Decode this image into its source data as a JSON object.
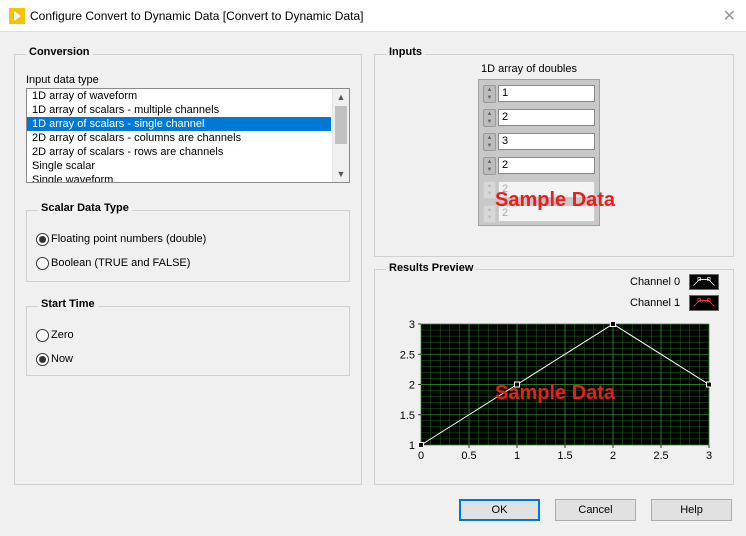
{
  "window": {
    "title": "Configure Convert to Dynamic Data [Convert to Dynamic Data]",
    "close_glyph": "✕"
  },
  "conversion": {
    "group_label": "Conversion",
    "input_type_label": "Input data type",
    "items": [
      "1D array of waveform",
      "1D array of scalars - multiple channels",
      "1D array of scalars - single channel",
      "2D array of scalars - columns are channels",
      "2D array of scalars - rows are channels",
      "Single scalar",
      "Single waveform"
    ],
    "selected_index": 2
  },
  "scalar_type": {
    "group_label": "Scalar Data Type",
    "options": [
      "Floating point numbers (double)",
      "Boolean (TRUE and FALSE)"
    ],
    "selected": 0
  },
  "start_time": {
    "group_label": "Start Time",
    "options": [
      "Zero",
      "Now"
    ],
    "selected": 1
  },
  "inputs": {
    "group_label": "Inputs",
    "array_label": "1D array of doubles",
    "values": [
      "1",
      "2",
      "3",
      "2"
    ],
    "disabled_values": [
      "2",
      "2"
    ],
    "watermark": "Sample Data"
  },
  "preview": {
    "group_label": "Results Preview",
    "legend": [
      {
        "name": "Channel 0",
        "color": "#ffffff"
      },
      {
        "name": "Channel 1",
        "color": "#ff4040"
      }
    ],
    "watermark": "Sample Data",
    "plot_bg": "#000000",
    "grid_color": "#1e6b1e"
  },
  "chart_data": {
    "type": "line",
    "x": [
      0,
      1,
      2,
      3
    ],
    "series": [
      {
        "name": "Channel 0",
        "values": [
          1,
          2,
          3,
          2
        ]
      }
    ],
    "xticks": [
      "0",
      "0.5",
      "1",
      "1.5",
      "2",
      "2.5",
      "3"
    ],
    "yticks": [
      "1",
      "1.5",
      "2",
      "2.5",
      "3"
    ],
    "xlim": [
      0,
      3
    ],
    "ylim": [
      1,
      3
    ],
    "grid": true
  },
  "buttons": {
    "ok": "OK",
    "cancel": "Cancel",
    "help": "Help"
  }
}
